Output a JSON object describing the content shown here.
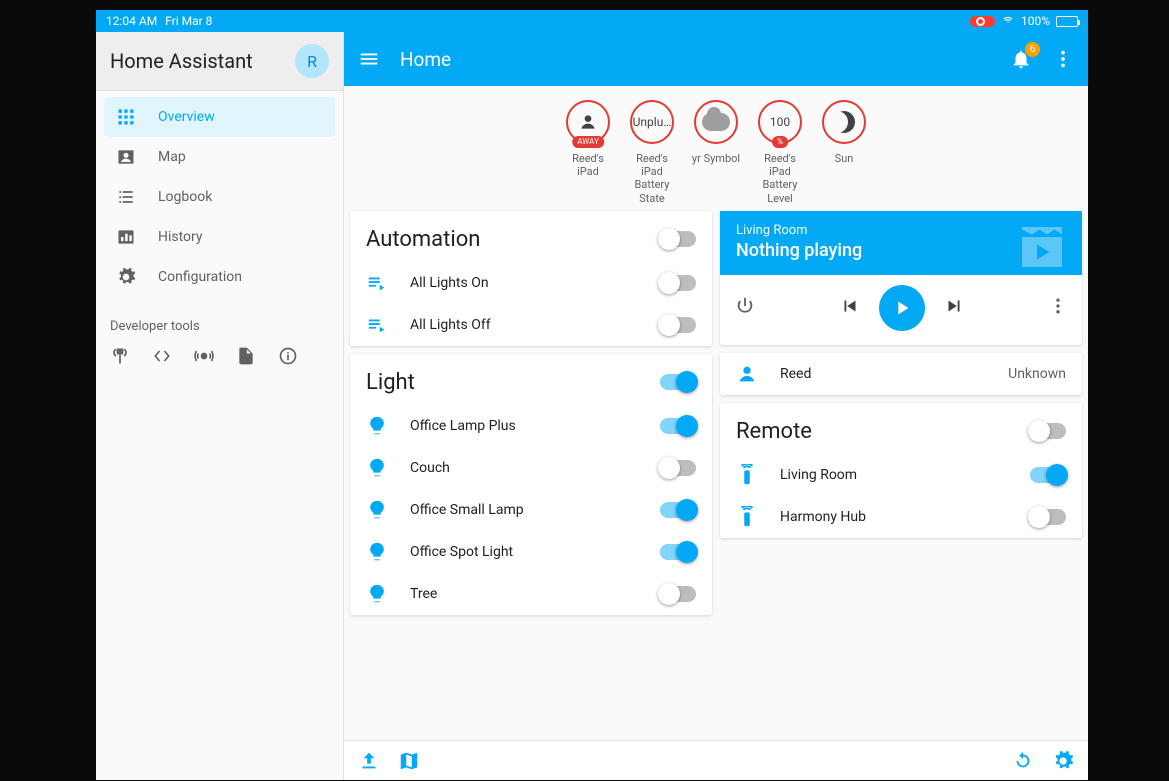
{
  "statusbar": {
    "time": "12:04 AM",
    "date": "Fri Mar 8",
    "battery": "100%"
  },
  "sidebar": {
    "title": "Home Assistant",
    "avatar_initial": "R",
    "items": [
      {
        "label": "Overview"
      },
      {
        "label": "Map"
      },
      {
        "label": "Logbook"
      },
      {
        "label": "History"
      },
      {
        "label": "Configuration"
      }
    ],
    "dev_label": "Developer tools"
  },
  "header": {
    "title": "Home",
    "notification_count": "6"
  },
  "badges": [
    {
      "inner": "person",
      "sub": "AWAY",
      "label": "Reed's iPad"
    },
    {
      "inner": "Unplu…",
      "sub": "",
      "label": "Reed's iPad Battery State"
    },
    {
      "inner": "cloud",
      "sub": "",
      "label": "yr Symbol"
    },
    {
      "inner": "100",
      "sub": "%",
      "label": "Reed's iPad Battery Level"
    },
    {
      "inner": "moon",
      "sub": "",
      "label": "Sun"
    }
  ],
  "automation": {
    "title": "Automation",
    "master_on": false,
    "items": [
      {
        "label": "All Lights On",
        "on": false
      },
      {
        "label": "All Lights Off",
        "on": false
      }
    ]
  },
  "light": {
    "title": "Light",
    "master_on": true,
    "items": [
      {
        "label": "Office Lamp Plus",
        "on": true,
        "color": "on2"
      },
      {
        "label": "Couch",
        "on": false,
        "color": "off"
      },
      {
        "label": "Office Small Lamp",
        "on": true,
        "color": "on2"
      },
      {
        "label": "Office Spot Light",
        "on": true,
        "color": "on"
      },
      {
        "label": "Tree",
        "on": false,
        "color": "off"
      }
    ]
  },
  "media": {
    "room": "Living Room",
    "status": "Nothing playing"
  },
  "person": {
    "name": "Reed",
    "state": "Unknown"
  },
  "remote": {
    "title": "Remote",
    "master_on": false,
    "items": [
      {
        "label": "Living Room",
        "on": true
      },
      {
        "label": "Harmony Hub",
        "on": false
      }
    ]
  }
}
